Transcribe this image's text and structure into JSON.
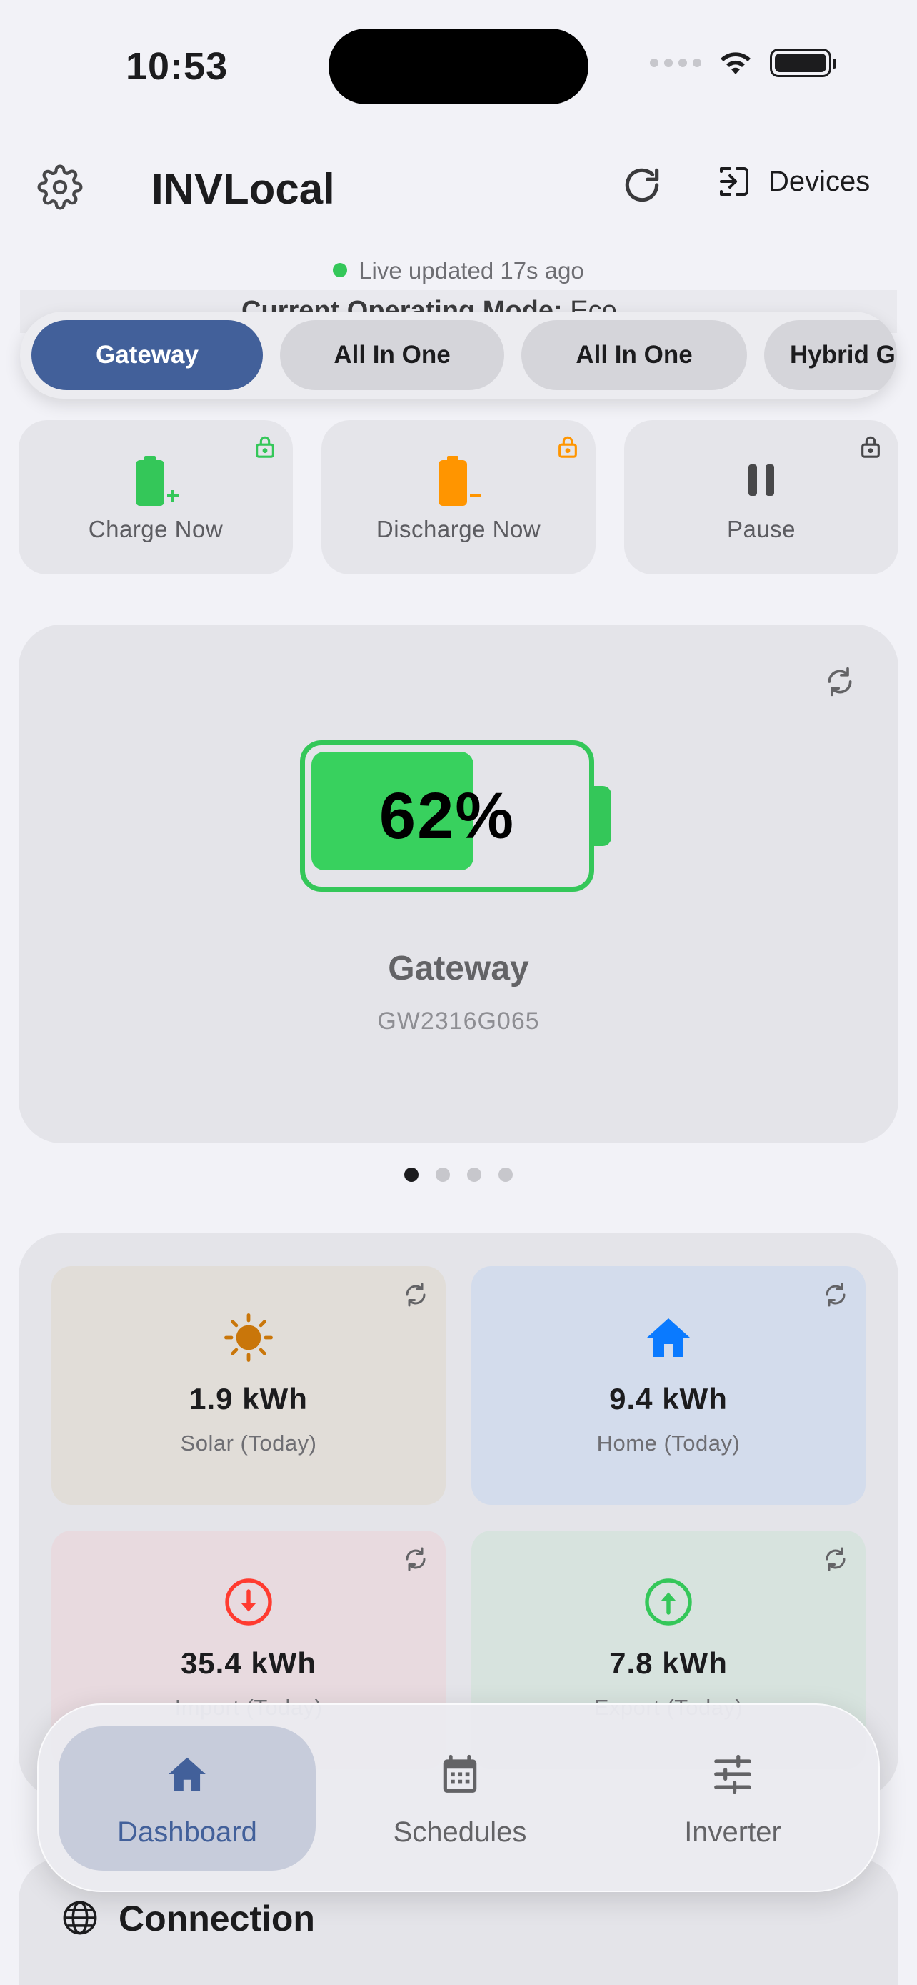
{
  "status_bar": {
    "time": "10:53"
  },
  "header": {
    "title": "INVLocal",
    "devices_label": "Devices"
  },
  "live_status": "Live updated 17s ago",
  "operating_mode": {
    "label": "Current Operating Mode:",
    "value": "Eco"
  },
  "device_tabs": [
    {
      "label": "Gateway",
      "active": true
    },
    {
      "label": "All In One",
      "active": false
    },
    {
      "label": "All In One",
      "active": false
    },
    {
      "label": "Hybrid G",
      "active": false
    }
  ],
  "actions": [
    {
      "label": "Charge Now",
      "icon": "battery-charge-icon",
      "color": "#34c759"
    },
    {
      "label": "Discharge Now",
      "icon": "battery-discharge-icon",
      "color": "#ff9500"
    },
    {
      "label": "Pause",
      "icon": "pause-icon",
      "color": "#48484a"
    }
  ],
  "battery": {
    "percent_text": "62%",
    "level": 0.62,
    "device_name": "Gateway",
    "serial": "GW2316G065",
    "color": "#34c759"
  },
  "carousel": {
    "pages": 4,
    "current": 0
  },
  "stats": [
    {
      "value": "1.9 kWh",
      "label": "Solar (Today)",
      "icon": "sun-icon",
      "bg": "#e1ddd8",
      "color": "#c9760a"
    },
    {
      "value": "9.4 kWh",
      "label": "Home (Today)",
      "icon": "home-icon",
      "bg": "#d3dcec",
      "color": "#0a7aff"
    },
    {
      "value": "35.4 kWh",
      "label": "Import (Today)",
      "icon": "arrow-down-circle-icon",
      "bg": "#e8dadf",
      "color": "#ff3b30"
    },
    {
      "value": "7.8 kWh",
      "label": "Export (Today)",
      "icon": "arrow-up-circle-icon",
      "bg": "#d7e3de",
      "color": "#34c759"
    }
  ],
  "connection": {
    "title": "Connection"
  },
  "tab_bar": [
    {
      "label": "Dashboard",
      "icon": "home-icon",
      "active": true
    },
    {
      "label": "Schedules",
      "icon": "calendar-icon",
      "active": false
    },
    {
      "label": "Inverter",
      "icon": "sliders-icon",
      "active": false
    }
  ],
  "colors": {
    "accent": "#42609a",
    "success": "#34c759",
    "warning": "#ff9500"
  }
}
